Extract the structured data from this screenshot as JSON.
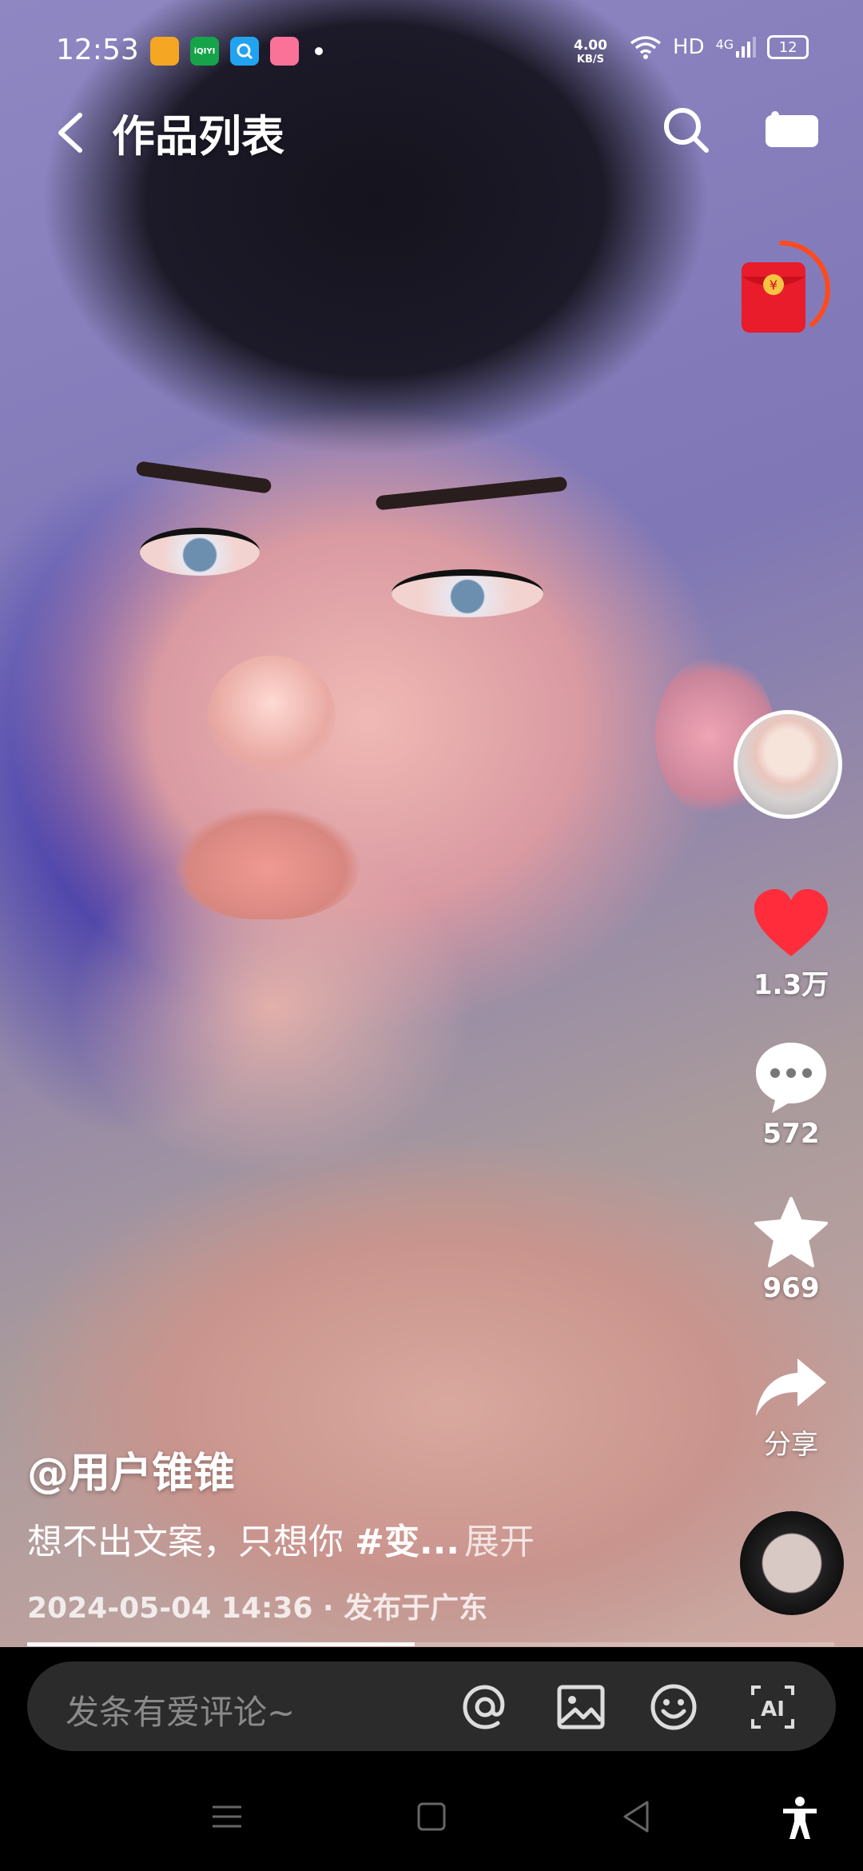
{
  "status_bar": {
    "time": "12:53",
    "apps": [
      {
        "name": "douyin-icon",
        "color": "#f5a623"
      },
      {
        "name": "iqiyi-icon",
        "label": "iQIYI",
        "color": "#16a34a"
      },
      {
        "name": "qq-browser-icon",
        "color": "#22a3f0"
      },
      {
        "name": "bilibili-icon",
        "color": "#fb7299"
      }
    ],
    "net_speed_value": "4.00",
    "net_speed_unit": "KB/S",
    "hd": "HD",
    "network": "4G",
    "battery": "12"
  },
  "nav": {
    "title": "作品列表"
  },
  "actions": {
    "likes": "1.3万",
    "comments": "572",
    "favorites": "969",
    "share": "分享"
  },
  "caption": {
    "author": "@用户锥锥",
    "text": "想不出文案，只想你 ",
    "tag": "#变...",
    "more": "展开",
    "meta": "2024-05-04 14:36 · 发布于广东"
  },
  "progress": 0.48,
  "comment_bar": {
    "placeholder": "发条有爱评论~"
  },
  "colors": {
    "like": "#ff2c3c",
    "comment_bg": "#2b2b2b"
  }
}
